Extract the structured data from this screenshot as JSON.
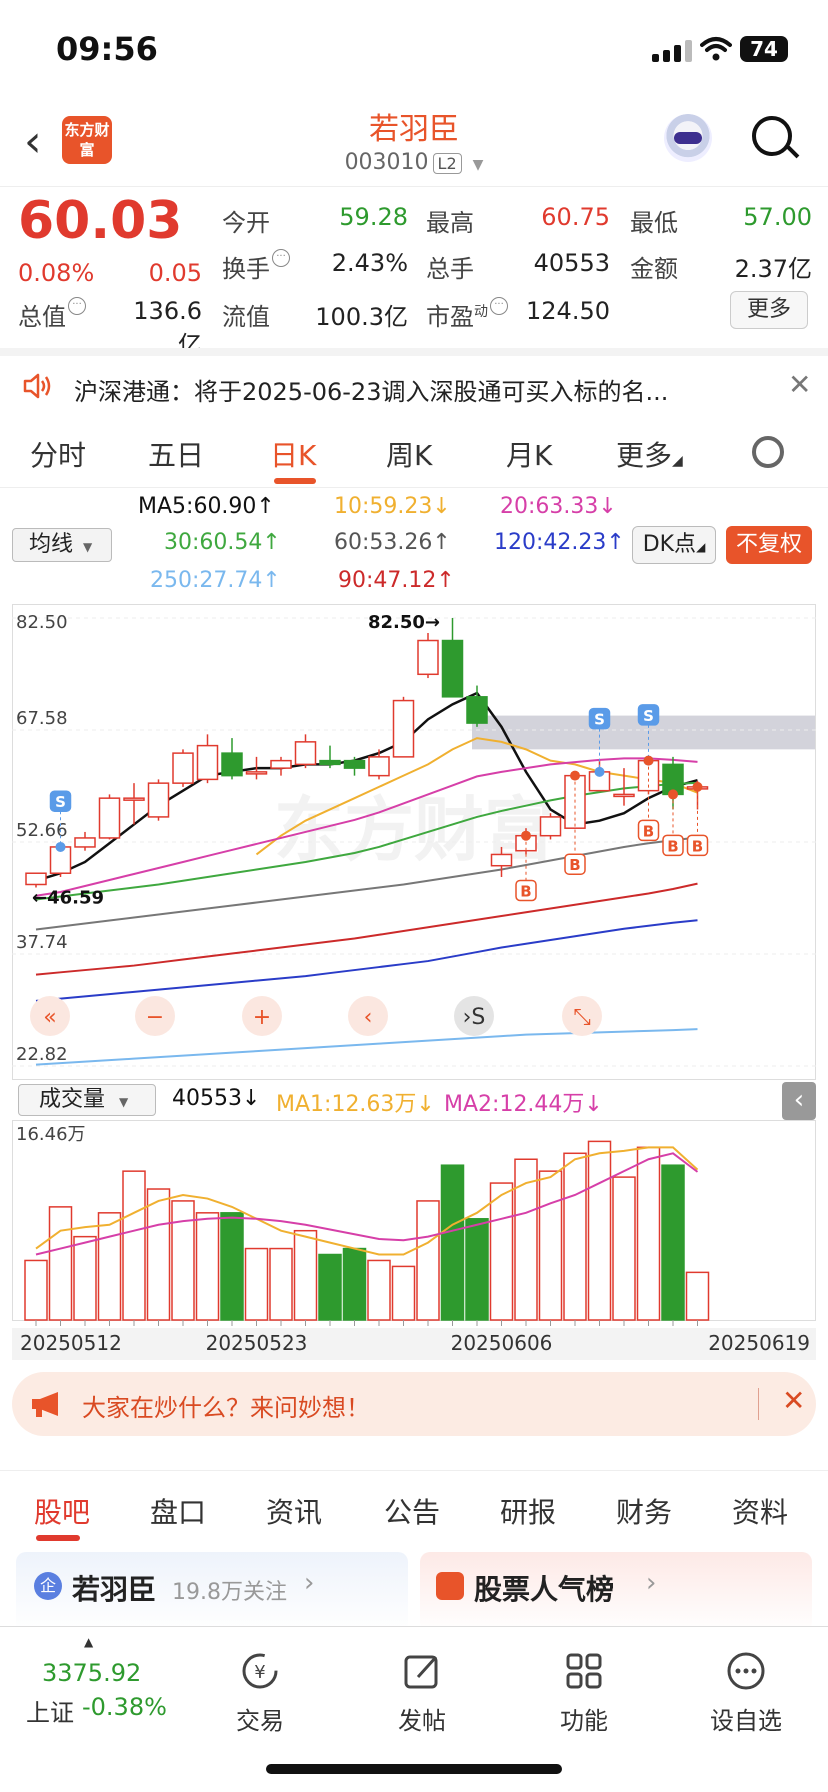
{
  "status_bar": {
    "time": "09:56",
    "battery": "74"
  },
  "header": {
    "logo": "东方财富",
    "name": "若羽臣",
    "code": "003010",
    "level": "L2"
  },
  "quote": {
    "price": "60.03",
    "change_pct": "0.08%",
    "change": "0.05",
    "open_label": "今开",
    "open": "59.28",
    "high_label": "最高",
    "high": "60.75",
    "low_label": "最低",
    "low": "57.00",
    "turnover_label": "换手",
    "turnover": "2.43%",
    "volume_label": "总手",
    "volume": "40553",
    "amount_label": "金额",
    "amount": "2.37亿",
    "mktcap_label": "总值",
    "mktcap": "136.6亿",
    "float_label": "流值",
    "float": "100.3亿",
    "pe_label": "市盈",
    "pe_sup": "动",
    "pe": "124.50",
    "more": "更多"
  },
  "notice": {
    "text": "沪深港通：将于2025-06-23调入深股通可买入标的名..."
  },
  "chart_tabs": [
    "分时",
    "五日",
    "日K",
    "周K",
    "月K",
    "更多"
  ],
  "ma_legend": {
    "select": "均线",
    "ma5": "MA5:60.90↑",
    "ma10": "10:59.23↓",
    "ma20": "20:63.33↓",
    "ma30": "30:60.54↑",
    "ma60": "60:53.26↑",
    "ma120": "120:42.23↑",
    "ma250": "250:27.74↑",
    "ma90": "90:47.12↑",
    "dk": "DK点",
    "fq": "不复权"
  },
  "chart_data": {
    "type": "candlestick",
    "y_ticks": [
      "82.50",
      "67.58",
      "52.66",
      "37.74",
      "22.82"
    ],
    "ylim": [
      22.82,
      82.5
    ],
    "annotations": {
      "max_label": "82.50→",
      "min_label": "←46.59"
    },
    "candles": [
      {
        "o": 47.0,
        "c": 48.5,
        "h": 48.5,
        "l": 46.6
      },
      {
        "o": 48.5,
        "c": 52.0,
        "h": 52.5,
        "l": 48.0
      },
      {
        "o": 52.0,
        "c": 53.2,
        "h": 54.0,
        "l": 51.5
      },
      {
        "o": 53.2,
        "c": 58.5,
        "h": 59.0,
        "l": 53.0
      },
      {
        "o": 58.5,
        "c": 58.5,
        "h": 60.5,
        "l": 55.0
      },
      {
        "o": 56.0,
        "c": 60.5,
        "h": 61.0,
        "l": 55.5
      },
      {
        "o": 60.5,
        "c": 64.5,
        "h": 65.0,
        "l": 60.0
      },
      {
        "o": 61.0,
        "c": 65.5,
        "h": 67.0,
        "l": 60.5
      },
      {
        "o": 64.5,
        "c": 61.5,
        "h": 66.5,
        "l": 61.0
      },
      {
        "o": 62.0,
        "c": 62.0,
        "h": 64.0,
        "l": 61.0
      },
      {
        "o": 62.5,
        "c": 63.5,
        "h": 64.0,
        "l": 61.5
      },
      {
        "o": 63.0,
        "c": 66.0,
        "h": 67.0,
        "l": 62.5
      },
      {
        "o": 63.5,
        "c": 63.0,
        "h": 65.5,
        "l": 62.5
      },
      {
        "o": 63.5,
        "c": 62.5,
        "h": 64.0,
        "l": 61.5
      },
      {
        "o": 61.5,
        "c": 64.0,
        "h": 65.0,
        "l": 61.0
      },
      {
        "o": 64.0,
        "c": 71.5,
        "h": 72.0,
        "l": 64.0
      },
      {
        "o": 75.0,
        "c": 79.5,
        "h": 80.5,
        "l": 74.5
      },
      {
        "o": 79.5,
        "c": 72.0,
        "h": 82.5,
        "l": 72.0
      },
      {
        "o": 72.0,
        "c": 68.5,
        "h": 73.5,
        "l": 68.0
      },
      {
        "o": 49.5,
        "c": 51.0,
        "h": 52.0,
        "l": 48.0
      },
      {
        "o": 51.5,
        "c": 53.5,
        "h": 54.5,
        "l": 51.0
      },
      {
        "o": 53.5,
        "c": 56.0,
        "h": 56.5,
        "l": 53.0
      },
      {
        "o": 54.5,
        "c": 61.5,
        "h": 62.0,
        "l": 54.5
      },
      {
        "o": 59.5,
        "c": 62.0,
        "h": 63.5,
        "l": 59.5
      },
      {
        "o": 59.0,
        "c": 59.0,
        "h": 62.5,
        "l": 57.5
      },
      {
        "o": 59.5,
        "c": 63.5,
        "h": 64.0,
        "l": 59.0
      },
      {
        "o": 63.0,
        "c": 59.0,
        "h": 64.0,
        "l": 57.0
      },
      {
        "o": 60.0,
        "c": 60.0,
        "h": 60.8,
        "l": 57.0
      }
    ],
    "ma_series": [
      {
        "name": "MA5",
        "color": "#111111",
        "values": [
          47.5,
          48.5,
          50.0,
          52.5,
          55.0,
          57.5,
          59.5,
          61.5,
          62.0,
          62.5,
          62.5,
          63.0,
          63.0,
          63.5,
          64.5,
          66.0,
          69.0,
          71.0,
          72.5,
          68.0,
          62.0,
          57.0,
          55.0,
          55.5,
          56.5,
          58.5,
          60.0,
          60.9
        ]
      },
      {
        "name": "MA10",
        "color": "#f0b030",
        "values": [
          null,
          null,
          null,
          null,
          null,
          null,
          null,
          null,
          null,
          51.0,
          53.5,
          55.5,
          57.0,
          58.5,
          60.0,
          61.5,
          63.0,
          65.0,
          66.5,
          66.0,
          65.0,
          63.5,
          63.0,
          62.0,
          61.5,
          61.0,
          60.5,
          59.23
        ]
      },
      {
        "name": "MA20",
        "color": "#d63fa8",
        "values": [
          45.5,
          46.0,
          46.8,
          47.6,
          48.4,
          49.2,
          50.0,
          50.8,
          51.6,
          52.4,
          53.2,
          54.0,
          54.8,
          55.6,
          56.6,
          57.8,
          59.0,
          60.2,
          61.4,
          62.0,
          62.5,
          63.0,
          63.3,
          63.6,
          63.8,
          63.8,
          63.6,
          63.33
        ]
      },
      {
        "name": "MA30",
        "color": "#3fa83f",
        "values": [
          45.0,
          45.4,
          45.8,
          46.2,
          46.6,
          47.0,
          47.5,
          48.0,
          48.5,
          49.0,
          49.5,
          50.0,
          50.6,
          51.2,
          52.0,
          53.0,
          54.0,
          55.0,
          56.0,
          56.8,
          57.5,
          58.2,
          58.8,
          59.3,
          59.8,
          60.1,
          60.4,
          60.54
        ]
      },
      {
        "name": "MA60",
        "color": "#777777",
        "values": [
          41.0,
          41.4,
          41.8,
          42.2,
          42.6,
          43.0,
          43.4,
          43.8,
          44.2,
          44.6,
          45.0,
          45.4,
          45.8,
          46.2,
          46.6,
          47.0,
          47.5,
          48.0,
          48.5,
          49.0,
          49.6,
          50.2,
          50.8,
          51.4,
          52.0,
          52.5,
          52.9,
          53.26
        ]
      },
      {
        "name": "MA90",
        "color": "#cc2a2a",
        "values": [
          35.0,
          35.3,
          35.6,
          35.9,
          36.2,
          36.6,
          37.0,
          37.4,
          37.8,
          38.2,
          38.6,
          39.0,
          39.4,
          39.8,
          40.3,
          40.8,
          41.3,
          41.8,
          42.3,
          42.8,
          43.3,
          43.8,
          44.3,
          44.8,
          45.3,
          45.8,
          46.4,
          47.12
        ]
      },
      {
        "name": "MA120",
        "color": "#2a3cc8",
        "values": [
          31.5,
          31.8,
          32.1,
          32.4,
          32.7,
          33.0,
          33.3,
          33.6,
          33.9,
          34.2,
          34.5,
          34.8,
          35.2,
          35.6,
          36.0,
          36.4,
          36.8,
          37.4,
          38.0,
          38.6,
          39.1,
          39.6,
          40.1,
          40.6,
          41.1,
          41.5,
          41.9,
          42.23
        ]
      },
      {
        "name": "MA250",
        "color": "#7ab8ee",
        "values": [
          23.0,
          23.2,
          23.4,
          23.6,
          23.8,
          24.0,
          24.2,
          24.4,
          24.6,
          24.8,
          25.0,
          25.2,
          25.4,
          25.6,
          25.8,
          26.0,
          26.2,
          26.4,
          26.6,
          26.8,
          27.0,
          27.1,
          27.2,
          27.3,
          27.4,
          27.5,
          27.6,
          27.74
        ]
      }
    ],
    "signals_buy": [
      20,
      22,
      25,
      26,
      27
    ],
    "signals_sell": [
      1,
      23,
      25
    ],
    "x_ticks": [
      "20250512",
      "20250523",
      "20250606",
      "20250619"
    ]
  },
  "chart_controls": [
    "«",
    "−",
    "+",
    "‹",
    "›S",
    "⤡"
  ],
  "volume": {
    "select": "成交量",
    "value": "40553↓",
    "ma1": "MA1:12.63万↓",
    "ma2": "MA2:12.44万↓",
    "max_label": "16.46万",
    "bars": [
      5.0,
      9.5,
      7.0,
      9.0,
      12.5,
      11.0,
      10.0,
      9.0,
      9.0,
      6.0,
      6.0,
      7.5,
      5.5,
      6.0,
      5.0,
      4.5,
      10.0,
      13.0,
      8.5,
      11.5,
      13.5,
      12.5,
      14.0,
      15.0,
      12.0,
      14.5,
      13.0,
      4.0
    ],
    "ma1_values": [
      6,
      7.5,
      7.8,
      8.0,
      9.0,
      10.0,
      10.5,
      10.2,
      9.5,
      8.5,
      7.5,
      7.0,
      6.5,
      6.0,
      5.5,
      5.5,
      6.5,
      8.0,
      9.0,
      10.5,
      11.5,
      12.0,
      13.5,
      14.0,
      14.2,
      14.5,
      14.5,
      12.63
    ],
    "ma2_values": [
      5.5,
      6.0,
      6.5,
      7.0,
      7.5,
      8.0,
      8.3,
      8.5,
      8.6,
      8.5,
      8.3,
      8.0,
      7.6,
      7.2,
      6.8,
      6.7,
      7.0,
      7.5,
      8.0,
      8.5,
      9.0,
      9.8,
      10.5,
      11.5,
      12.5,
      13.5,
      14.0,
      12.44
    ]
  },
  "ask_bar": {
    "text": "大家在炒什么？来问妙想！"
  },
  "bottom_tabs": [
    "股吧",
    "盘口",
    "资讯",
    "公告",
    "研报",
    "财务",
    "资料"
  ],
  "cards": {
    "left_title": "若羽臣",
    "left_sub": "19.8万关注",
    "right_title": "股票人气榜"
  },
  "bottom_nav": {
    "index_value": "3375.92",
    "index_name": "上证",
    "index_change": "-0.38%",
    "trade": "交易",
    "post": "发帖",
    "func": "功能",
    "watch": "设自选"
  }
}
